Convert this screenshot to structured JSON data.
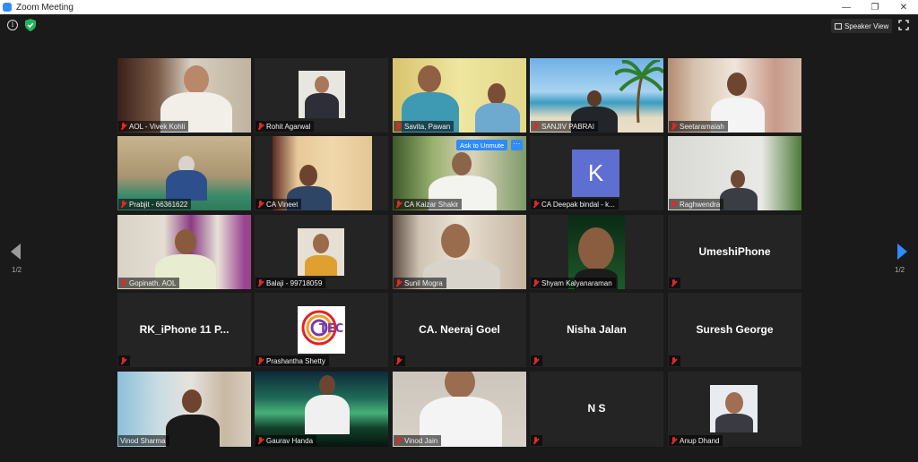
{
  "window": {
    "title": "Zoom Meeting"
  },
  "window_controls": {
    "minimize": "—",
    "maximize": "❐",
    "close": "✕"
  },
  "topbar": {
    "speaker_view_label": "Speaker View"
  },
  "pagination": {
    "left": "1/2",
    "right": "1/2"
  },
  "colors": {
    "active_speaker": "#8fdc3a",
    "accent": "#2d8cff",
    "muted": "#e02828"
  },
  "participants": [
    {
      "name": "AOL - Vivek Kohli"
    },
    {
      "name": "Rohit Agarwal"
    },
    {
      "name": "Savita, Pawan"
    },
    {
      "name": "SANJIV PABRAI"
    },
    {
      "name": "Seetaramaiah"
    },
    {
      "name": "Prabjit - 66361622"
    },
    {
      "name": "CA Vineet"
    },
    {
      "name": "CA Kaizar Shakir",
      "ask_to_unmute": "Ask to Unmute",
      "more": "···"
    },
    {
      "name": "CA Deepak bindal - k...",
      "avatar_letter": "K"
    },
    {
      "name": "Raghwendra"
    },
    {
      "name": "Gopinath. AOL"
    },
    {
      "name": "Balaji - 99718059"
    },
    {
      "name": "Sunil Mogra"
    },
    {
      "name": "Shyam Kalyanaraman"
    },
    {
      "name": "UmeshiPhone"
    },
    {
      "name": "RK_iPhone 11 P..."
    },
    {
      "name": "Prashantha Shetty",
      "logo_text": "TEC"
    },
    {
      "name": "CA. Neeraj Goel"
    },
    {
      "name": "Nisha Jalan"
    },
    {
      "name": "Suresh George"
    },
    {
      "name": "Vinod Sharma",
      "active_speaker": true
    },
    {
      "name": "Gaurav Handa"
    },
    {
      "name": "Vinod Jain"
    },
    {
      "name": "N S"
    },
    {
      "name": "Anup Dhand"
    }
  ]
}
